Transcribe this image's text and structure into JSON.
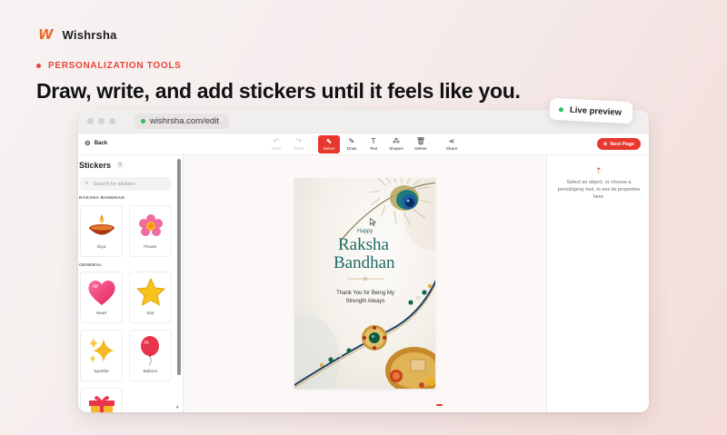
{
  "brand": {
    "logo": "W",
    "name": "Wishrsha"
  },
  "eyebrow": "PERSONALIZATION TOOLS",
  "headline": "Draw, write, and add stickers until it feels like you.",
  "live_preview": "Live preview",
  "browser": {
    "url": "wishrsha.com/edit"
  },
  "toolbar": {
    "back": "Back",
    "tools": [
      {
        "label": "Undo",
        "icon": "undo-icon"
      },
      {
        "label": "Redo",
        "icon": "redo-icon"
      },
      {
        "label": "Select",
        "icon": "cursor-icon"
      },
      {
        "label": "Draw",
        "icon": "pencil-icon"
      },
      {
        "label": "Text",
        "icon": "text-icon"
      },
      {
        "label": "Shapes",
        "icon": "shapes-icon"
      },
      {
        "label": "Delete",
        "icon": "trash-icon"
      },
      {
        "label": "Share",
        "icon": "share-icon"
      }
    ],
    "next_page": "Next Page"
  },
  "stickers": {
    "title": "Stickers",
    "help": "?",
    "search_placeholder": "Search for stickers",
    "sections": [
      {
        "label": "RAKSHA BANDHAN",
        "items": [
          "Diya",
          "Flower"
        ]
      },
      {
        "label": "GENERAL",
        "items": [
          "Heart",
          "Star",
          "Sparkle",
          "Balloon"
        ]
      }
    ]
  },
  "card": {
    "happy": "Happy",
    "raksha": "Raksha",
    "bandhan": "Bandhan",
    "message": "Thank You for Being My Strength Always"
  },
  "properties": {
    "message": "Select an object, or choose a pencil/spray tool, to see its properties here."
  },
  "colors": {
    "accent": "#e8382e",
    "brand": "#ef6a2f",
    "card_text": "#1f6a62",
    "online": "#2bbf61"
  }
}
